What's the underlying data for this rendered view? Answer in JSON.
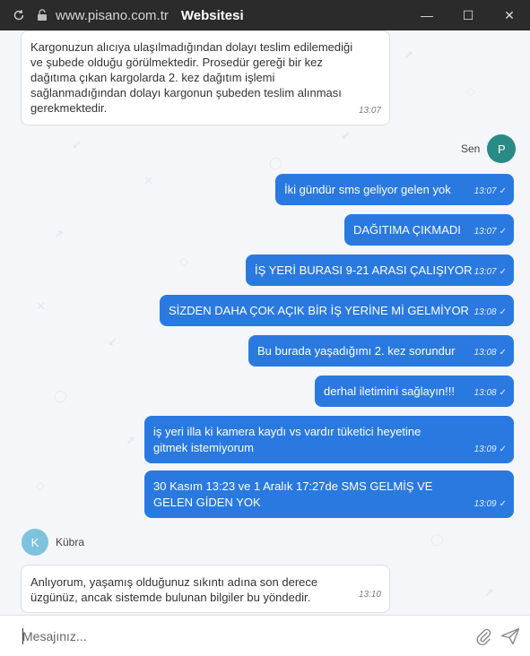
{
  "titlebar": {
    "url": "www.pisano.com.tr",
    "title": "Websitesi",
    "refresh_icon": "refresh-icon",
    "lock_icon": "lock-icon",
    "minimize": "—",
    "maximize": "☐",
    "close": "✕"
  },
  "messages": {
    "agent_first": {
      "text": "Kargonuzun alıcıya ulaşılmadığından dolayı teslim edilemediği ve şubede olduğu görülmektedir. Prosedür gereği bir kez dağıtıma çıkan kargolarda 2. kez dağıtım işlemi sağlanmadığından dolayı kargonun şubeden teslim alınması gerekmektedir.",
      "time": "13:07"
    },
    "user_sender": {
      "name": "Sen",
      "initial": "P",
      "color": "#2a8a86"
    },
    "user": [
      {
        "text": "İki gündür sms geliyor gelen yok",
        "time": "13:07"
      },
      {
        "text": "DAĞITIMA ÇIKMADI",
        "time": "13:07"
      },
      {
        "text": "İŞ YERİ BURASI 9-21 ARASI ÇALIŞIYOR",
        "time": "13:07"
      },
      {
        "text": "SİZDEN DAHA ÇOK AÇIK BİR İŞ YERİNE Mİ GELMİYOR",
        "time": "13:08"
      },
      {
        "text": "Bu burada yaşadığımı 2. kez sorundur",
        "time": "13:08"
      },
      {
        "text": "derhal iletimini sağlayın!!!",
        "time": "13:08"
      },
      {
        "text": "iş yeri illa ki kamera kaydı vs vardır tüketici heyetine gitmek istemiyorum",
        "time": "13:09"
      },
      {
        "text": "30 Kasım 13:23 ve 1 Aralık 17:27de SMS GELMİŞ VE GELEN GİDEN YOK",
        "time": "13:09"
      }
    ],
    "check": "✓",
    "agent_sender": {
      "name": "Kübra",
      "initial": "K",
      "color": "#7ec3dd"
    },
    "agent_last": {
      "text": "Anlıyorum, yaşamış olduğunuz sıkıntı adına son derece üzgünüz, ancak sistemde bulunan bilgiler bu yöndedir.",
      "time": "13:10"
    }
  },
  "composer": {
    "placeholder": "Mesajınız...",
    "attach_icon": "paperclip-icon",
    "send_icon": "send-icon"
  },
  "colors": {
    "titlebar": "#2b2b2b",
    "user_bubble": "#2a79e1",
    "chat_background": "#f4f6f9"
  }
}
